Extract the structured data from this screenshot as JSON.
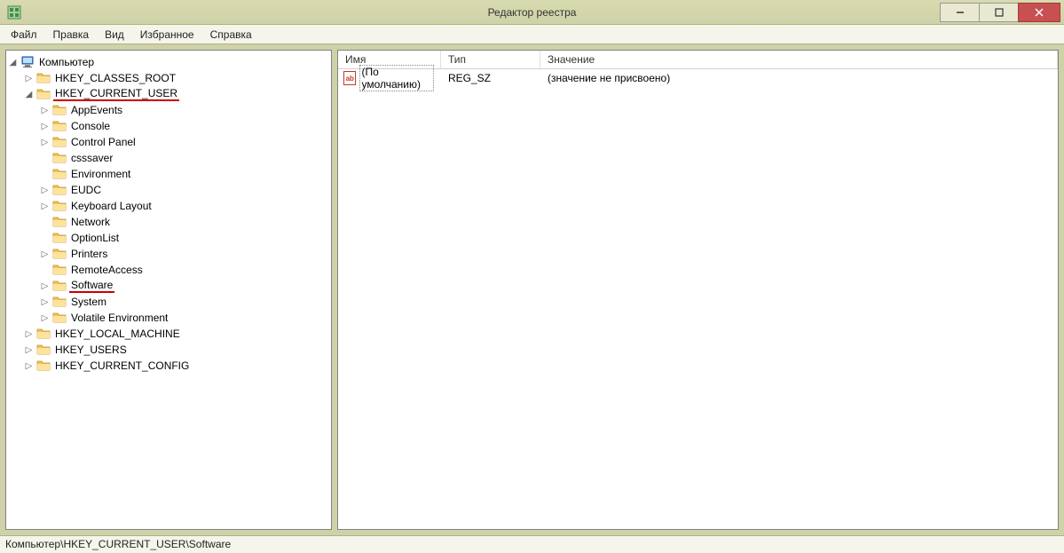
{
  "window": {
    "title": "Редактор реестра"
  },
  "menu": [
    "Файл",
    "Правка",
    "Вид",
    "Избранное",
    "Справка"
  ],
  "tree": {
    "root": {
      "label": "Компьютер",
      "expanded": true
    },
    "hives": [
      {
        "label": "HKEY_CLASSES_ROOT",
        "expanded": false,
        "children": [],
        "underline": false
      },
      {
        "label": "HKEY_CURRENT_USER",
        "expanded": true,
        "underline": true,
        "children": [
          {
            "label": "AppEvents",
            "hasChildren": true
          },
          {
            "label": "Console",
            "hasChildren": true
          },
          {
            "label": "Control Panel",
            "hasChildren": true
          },
          {
            "label": "csssaver",
            "hasChildren": false
          },
          {
            "label": "Environment",
            "hasChildren": false
          },
          {
            "label": "EUDC",
            "hasChildren": true
          },
          {
            "label": "Keyboard Layout",
            "hasChildren": true
          },
          {
            "label": "Network",
            "hasChildren": false
          },
          {
            "label": "OptionList",
            "hasChildren": false
          },
          {
            "label": "Printers",
            "hasChildren": true
          },
          {
            "label": "RemoteAccess",
            "hasChildren": false
          },
          {
            "label": "Software",
            "hasChildren": true,
            "underline": true
          },
          {
            "label": "System",
            "hasChildren": true
          },
          {
            "label": "Volatile Environment",
            "hasChildren": true
          }
        ]
      },
      {
        "label": "HKEY_LOCAL_MACHINE",
        "expanded": false,
        "children": []
      },
      {
        "label": "HKEY_USERS",
        "expanded": false,
        "children": []
      },
      {
        "label": "HKEY_CURRENT_CONFIG",
        "expanded": false,
        "children": []
      }
    ]
  },
  "list": {
    "headers": {
      "name": "Имя",
      "type": "Тип",
      "value": "Значение"
    },
    "rows": [
      {
        "name": "(По умолчанию)",
        "type": "REG_SZ",
        "value": "(значение не присвоено)"
      }
    ]
  },
  "statusbar": "Компьютер\\HKEY_CURRENT_USER\\Software",
  "icons": {
    "folder_svg": "<svg viewBox='0 0 16 16'><path fill='#f3c35a' stroke='#b8922a' stroke-width='0.7' d='M1 3h5l2 2h7v8H1z'/><path fill='#ffe39b' d='M1 6h14v7H1z'/></svg>",
    "computer_svg": "<svg viewBox='0 0 16 16'><rect x='2' y='2' width='12' height='8' fill='#4a90d9' stroke='#2a5a99'/><rect x='3' y='3' width='10' height='6' fill='#bde0ff'/><rect x='5' y='11' width='6' height='2' fill='#888'/><rect x='3' y='13' width='10' height='1' fill='#666'/></svg>",
    "app_svg": "<svg viewBox='0 0 16 16'><rect x='1' y='1' width='14' height='14' fill='#9fd49f' stroke='#4a884a'/><rect x='3' y='3' width='4' height='4' fill='#4a884a'/><rect x='9' y='3' width='4' height='4' fill='#4a884a'/><rect x='3' y='9' width='4' height='4' fill='#4a884a'/><rect x='9' y='9' width='4' height='4' fill='#4a884a'/></svg>"
  }
}
